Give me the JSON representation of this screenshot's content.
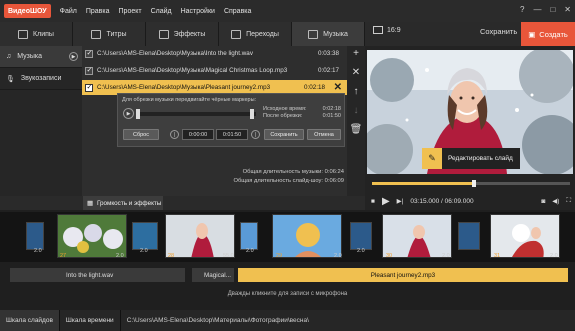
{
  "app": {
    "logo": "ВидеоШОУ"
  },
  "menu": [
    "Файл",
    "Правка",
    "Проект",
    "Слайд",
    "Настройки",
    "Справка"
  ],
  "window_buttons": [
    "?",
    "—",
    "□",
    "✕"
  ],
  "tabs": [
    {
      "label": "Клипы"
    },
    {
      "label": "Титры"
    },
    {
      "label": "Эффекты"
    },
    {
      "label": "Переходы"
    },
    {
      "label": "Музыка"
    }
  ],
  "top_right": {
    "ratio": "16:9",
    "save": "Сохранить",
    "create": "Создать"
  },
  "sidenav": [
    {
      "label": "Музыка"
    },
    {
      "label": "Звукозаписи"
    }
  ],
  "music": [
    {
      "path": "C:\\Users\\AMS-Elena\\Desktop\\Музыка\\Into the light.wav",
      "duration": "0:03:38"
    },
    {
      "path": "C:\\Users\\AMS-Elena\\Desktop\\Музыка\\Magical Christmas Loop.mp3",
      "duration": "0:02:17"
    },
    {
      "path": "C:\\Users\\AMS-Elena\\Desktop\\Музыка\\Pleasant journey2.mp3",
      "duration": "0:02:18"
    }
  ],
  "trim": {
    "hint": "Для обрезки музыки передвигайте чёрные маркеры:",
    "orig_label": "Исходное время:",
    "orig_value": "0:02:18",
    "after_label": "После обрезки:",
    "after_value": "0:01:50",
    "reset": "Сброс",
    "start": "0:00:00",
    "end": "0:01:50",
    "save": "Сохранить",
    "cancel": "Отмена"
  },
  "totals": {
    "music_label": "Общая длительность музыки:",
    "music_value": "0:06:24",
    "show_label": "Общая длительность слайд-шоу:",
    "show_value": "0:06:09"
  },
  "preview": {
    "edit_slide": "Редактировать слайд"
  },
  "player": {
    "time": "03:15.000 / 06:09.000"
  },
  "volume_effects": "Громкость и эффекты",
  "slides": [
    {
      "num": "27",
      "len": "2.0",
      "tlen": "2.0",
      "color": "#2c6aa8"
    },
    {
      "num": "28",
      "len": "2.0",
      "tlen": "",
      "color": "#2d6ea0"
    },
    {
      "num": "",
      "len": "",
      "tlen": "",
      "color": "#ddd"
    },
    {
      "num": "29",
      "len": "55.0",
      "tlen": "2.0",
      "color": "#5a9ad6"
    },
    {
      "num": "30",
      "len": "2.0",
      "tlen": "2.0",
      "color": "#c06060"
    },
    {
      "num": "31",
      "len": "2.0",
      "tlen": "",
      "color": "#5a9ad6"
    },
    {
      "num": "32",
      "len": "2.0",
      "tlen": "",
      "color": "#d05050"
    }
  ],
  "audio": [
    {
      "label": "Into the light.wav"
    },
    {
      "label": "Magical..."
    },
    {
      "label": "Pleasant journey2.mp3"
    }
  ],
  "record_hint": "Дважды кликните для записи с микрофона",
  "status": {
    "tab1": "Шкала слайдов",
    "tab2": "Шкала времени",
    "path": "C:\\Users\\AMS-Elena\\Desktop\\Материалы\\Фотографии\\весна\\"
  },
  "colors": {
    "accent": "#e8563a",
    "highlight": "#f0c050"
  }
}
